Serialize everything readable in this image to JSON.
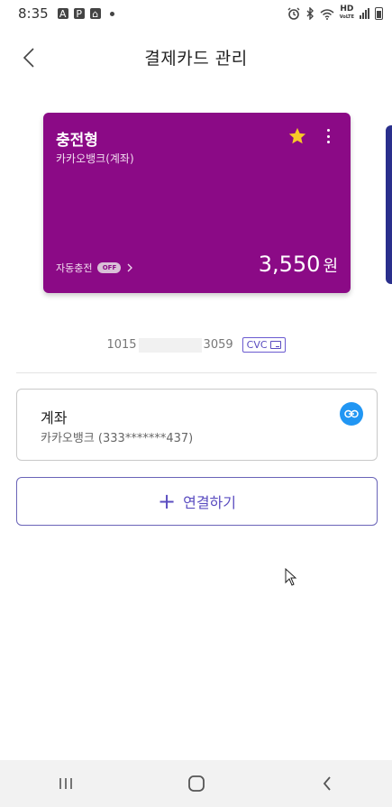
{
  "status_bar": {
    "time": "8:35",
    "hd_label": "HD",
    "hd_sub": "VoLTE"
  },
  "header": {
    "title": "결제카드 관리",
    "back_icon": "chevron-left-icon"
  },
  "card": {
    "name": "충전형",
    "bank": "카카오뱅크(계좌)",
    "auto_charge_label": "자동충전",
    "auto_charge_state": "OFF",
    "balance": "3,550",
    "currency": "원",
    "color": "#8b0a86",
    "favorite": true
  },
  "card_number": {
    "prefix": "1015",
    "suffix": "3059",
    "cvc_label": "CVC"
  },
  "account": {
    "title": "계좌",
    "detail": "카카오뱅크 (333*******437)",
    "link_icon_color": "#2196f3"
  },
  "connect_button": {
    "label": "연결하기",
    "color": "#5a4cc0"
  },
  "nav_bar": {
    "items": [
      "recent-apps-icon",
      "home-icon",
      "back-icon"
    ]
  }
}
